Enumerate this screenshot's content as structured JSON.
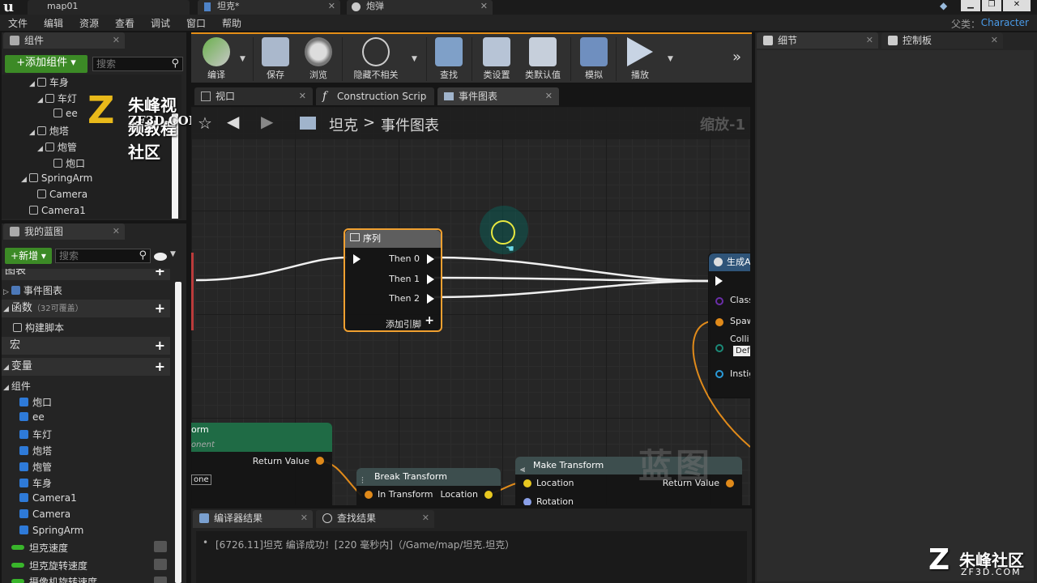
{
  "title_tabs": [
    {
      "label": "map01"
    },
    {
      "label": "坦克*"
    },
    {
      "label": "炮弹"
    }
  ],
  "menu": [
    "文件",
    "编辑",
    "资源",
    "查看",
    "调试",
    "窗口",
    "帮助"
  ],
  "parent": {
    "label": "父类：",
    "value": "Character"
  },
  "components_panel": {
    "tab": "组件",
    "add_button": "+添加组件 ▾",
    "search_placeholder": "搜索",
    "tree": [
      "车身",
      "车灯",
      "ee",
      "炮塔",
      "炮管",
      "炮口",
      "SpringArm",
      "Camera",
      "Camera1"
    ]
  },
  "my_blueprint": {
    "tab": "我的蓝图",
    "new_button": "+新增 ▾",
    "search_placeholder": "搜索",
    "graphs_section": "图表",
    "event_graph": "事件图表",
    "functions_section": "函数",
    "functions_note": "（32可覆盖）",
    "construction_script": "构建脚本",
    "macros_section": "宏",
    "variables_section": "变量",
    "components_category": "组件",
    "component_vars": [
      "炮口",
      "ee",
      "车灯",
      "炮塔",
      "炮管",
      "车身",
      "Camera1",
      "Camera",
      "SpringArm"
    ],
    "float_vars": [
      "坦克速度",
      "坦克旋转速度",
      "摄像机旋转速度"
    ]
  },
  "toolbar": {
    "compile": "编译",
    "save": "保存",
    "browse": "浏览",
    "hide_unrelated": "隐藏不相关",
    "find": "查找",
    "class_settings": "类设置",
    "class_defaults": "类默认值",
    "simulate": "模拟",
    "play": "播放"
  },
  "graph_tabs": {
    "viewport": "视口",
    "construction": "Construction Scrip",
    "event_graph": "事件图表"
  },
  "graph": {
    "crumb_root": "坦克",
    "crumb_sep": ">",
    "crumb_current": "事件图表",
    "zoom": "缩放-1",
    "watermark": "蓝图",
    "sequence_node": {
      "title": "序列",
      "then0": "Then 0",
      "then1": "Then 1",
      "then2": "Then 2",
      "add_pin": "添加引脚"
    },
    "spawn_node": {
      "title": "生成A",
      "class": "Class",
      "spawn": "Spaw",
      "collision": "Colli",
      "default": "Def",
      "instigator": "Instig"
    },
    "left_node": {
      "title": "orm",
      "subtitle": "onent",
      "return_value": "Return Value",
      "none": "one"
    },
    "break_node": {
      "title": "Break Transform",
      "in": "In Transform",
      "location": "Location"
    },
    "make_node": {
      "title": "Make Transform",
      "location": "Location",
      "rotation": "Rotation",
      "return_value": "Return Value"
    }
  },
  "bottom": {
    "compiler_tab": "编译器结果",
    "find_tab": "查找结果",
    "log": "[6726.11]坦克 编译成功！[220 毫秒内]（/Game/map/坦克.坦克）"
  },
  "right_panel": {
    "details_tab": "细节",
    "palette_tab": "控制板"
  },
  "watermarks": {
    "top_title": "朱峰视频教程社区",
    "top_url": "ZF3D.COM",
    "bottom_title": "朱峰社区",
    "bottom_url": "ZF3D.COM"
  },
  "colors": {
    "accent_orange": "#e58e16",
    "green": "#3c8a26",
    "link_blue": "#4a9be8"
  }
}
